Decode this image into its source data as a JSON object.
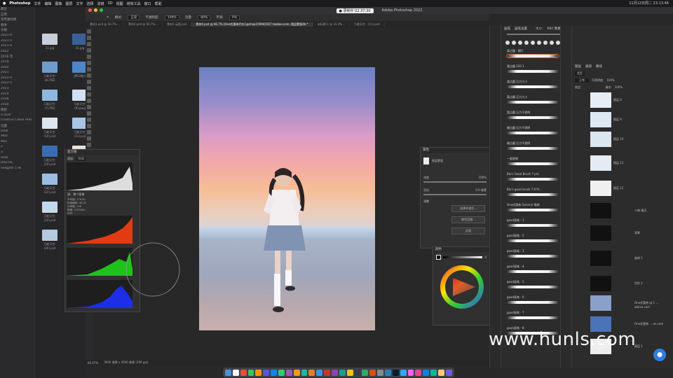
{
  "menubar": {
    "apple": "",
    "app": "Photoshop",
    "items": [
      "文件",
      "编辑",
      "图像",
      "图层",
      "文字",
      "选择",
      "滤镜",
      "3D",
      "视图",
      "增效工具",
      "窗口",
      "帮助"
    ],
    "clock": "11月12日周二 23:13:46"
  },
  "recording": {
    "label": "● 录制中 02:37:30"
  },
  "ps": {
    "title": "Adobe Photoshop 2022",
    "mode_label": "模式:",
    "mode_value": "正常",
    "opacity_label": "不透明度:",
    "opacity_value": "100%",
    "flow_label": "流量:",
    "flow_value": "80%",
    "smooth_label": "平滑:",
    "smooth_value": "0%"
  },
  "tabs": [
    "素材1.psd @ 50.7%...",
    "素材2.psd @ 66.7%...",
    "素材3 云图.psd",
    "素材4.psd @ 66.7% (One优惠卷代价1@shop159941927.taobao.com, 图层蒙版/8) *",
    "未标题-1 @ 33.3%...",
    "万能天空 - (11).psd"
  ],
  "status": {
    "zoom": "66.67%",
    "doc": "3000 像素 x 4500 像素 (300 ppi)"
  },
  "finder": {
    "sidebar": [
      "最近",
      "应用",
      "常用素材库",
      "春季",
      "文稿",
      "2021-4",
      "2021-5",
      "2021-6",
      "2022",
      "2016 年",
      "2019",
      "2020",
      "2021",
      "2022-4",
      "2022-5",
      "2023",
      "2019",
      "2018",
      "2020",
      "硬盘",
      "iCloud",
      "Creative Cloud Files",
      "位置",
      "DISK",
      "iMac",
      "Mac",
      "2",
      "3",
      "HDD",
      "DIGITAL",
      "Seagate 1TB"
    ],
    "files": [
      "11.jpg",
      "21.jpg",
      "万能天空-(8).PSD",
      "JPEG格式",
      "万能天空-(7).PSD",
      "万能天空-(9).jpeg",
      "万能天空-(10).psd",
      "万能天空-(11).psd",
      "万能天空-(20).psd",
      "万能天空-(21).psd",
      "万能天空-(22).psd",
      "万能天空-(23).psd",
      "万能天空-(24).psd",
      "万能天空-(25).psd",
      "万能天空-(26).psd"
    ]
  },
  "histogram": {
    "title": "直方图",
    "channel_label": "通道:",
    "channel_value": "RGB",
    "source_label": "源:",
    "source_value": "整个图像",
    "stats": [
      "平均值: 176.40",
      "标准偏差: 48.32",
      "中间值: 190",
      "像素: 5750000",
      "色阶:",
      "数量:",
      "百分位:",
      "高速缓存级别: 3"
    ]
  },
  "props": {
    "title": "属性",
    "layer_label": "图层蒙版",
    "density_label": "浓度",
    "density_value": "100%",
    "feather_label": "羽化",
    "feather_value": "0.0 像素",
    "adjust_label": "调整",
    "btn1": "选择并遮住...",
    "btn2": "颜色范围...",
    "btn3": "反相"
  },
  "color": {
    "title": "颜色",
    "value": "0"
  },
  "brushes": {
    "tab1": "画笔",
    "tab2": "画笔设置",
    "size_label": "大小:",
    "size_value": "692 像素",
    "items": [
      "柔边圆 - 鳞片",
      "柔边圆 250 1",
      "柔边圆 压力大小",
      "柔边圆 压力大小",
      "柔边圆 压力不透明",
      "硬边圆 压力不透明",
      "硬边圆 压力不透明",
      "一般画笔",
      "Blu's Good Brush 7 pro",
      "Blu's good brush 7.0 Pr...",
      "One优惠券 General 笔刷",
      "good画笔 - 1",
      "good画笔 - 2",
      "good画笔 - 3",
      "good画笔 - 4",
      "good画笔 - 5",
      "good画笔 - 6",
      "good画笔 - 7",
      "good画笔 - 8"
    ]
  },
  "layers": {
    "tab1": "图层",
    "tab2": "通道",
    "tab3": "路径",
    "kind": "类型",
    "blend": "正常",
    "opacity_label": "不透明度:",
    "opacity_value": "100%",
    "lock_label": "锁定:",
    "fill_label": "填充:",
    "fill_value": "100%",
    "names": [
      "图层 8",
      "图层 9",
      "图层 10",
      "图层 11",
      "图层 12",
      "人物 精灵",
      "背景",
      "曲线 1",
      "色阶 1",
      "One优惠券 @ 1 ... above.com",
      "One优惠券 ... on.com",
      "图层 1"
    ]
  },
  "watermark": "www.hunls.com",
  "colors": {
    "accent": "#3b82d6",
    "bg": "#282828"
  }
}
